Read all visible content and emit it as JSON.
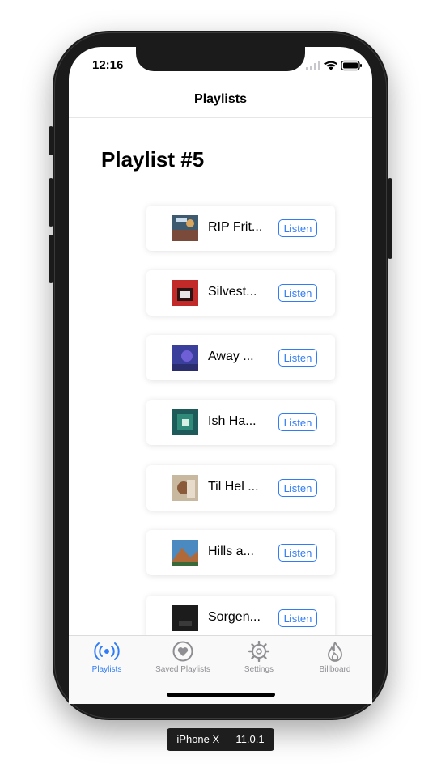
{
  "status_bar": {
    "time": "12:16"
  },
  "nav": {
    "title": "Playlists"
  },
  "page": {
    "title": "Playlist #5"
  },
  "tracks": [
    {
      "title": "RIP Frit...",
      "listen_label": "Listen"
    },
    {
      "title": "Silvest...",
      "listen_label": "Listen"
    },
    {
      "title": "Away ...",
      "listen_label": "Listen"
    },
    {
      "title": "Ish Ha...",
      "listen_label": "Listen"
    },
    {
      "title": "Til Hel ...",
      "listen_label": "Listen"
    },
    {
      "title": "Hills a...",
      "listen_label": "Listen"
    },
    {
      "title": "Sorgen...",
      "listen_label": "Listen"
    }
  ],
  "tabbar": {
    "tabs": [
      {
        "label": "Playlists",
        "icon": "broadcast-icon",
        "active": true
      },
      {
        "label": "Saved Playlists",
        "icon": "heart-circle-icon",
        "active": false
      },
      {
        "label": "Settings",
        "icon": "gear-icon",
        "active": false
      },
      {
        "label": "Billboard",
        "icon": "flame-icon",
        "active": false
      }
    ]
  },
  "device_label": "iPhone X — 11.0.1",
  "colors": {
    "accent": "#2f7cf6",
    "inactive": "#8e8e93",
    "frame": "#1b1b1b"
  }
}
